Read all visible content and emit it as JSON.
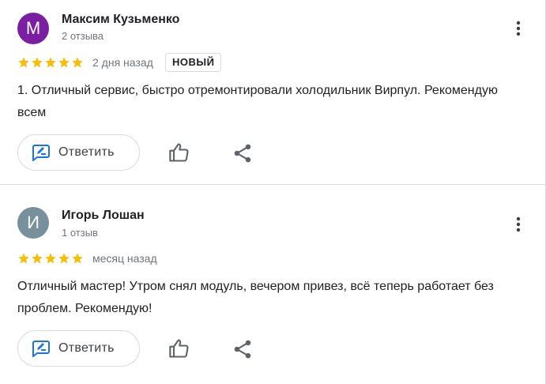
{
  "colors": {
    "avatar_1": "#7b1fa2",
    "avatar_2": "#78909c",
    "star": "#fbbc04",
    "accent": "#1a73e8",
    "text_secondary": "#70757a",
    "divider": "#dadce0"
  },
  "reviews": [
    {
      "avatar_letter": "М",
      "author": "Максим Кузьменко",
      "review_count": "2 отзыва",
      "rating": 5,
      "date": "2 дня назад",
      "badge": "НОВЫЙ",
      "text": "1. Отличный сервис, быстро отремонтировали холодильник Вирпул. Рекомендую всем",
      "reply_label": "Ответить",
      "icons": [
        "more-vert-icon",
        "star-icon",
        "reply-edit-icon",
        "thumb-up-icon",
        "share-icon"
      ]
    },
    {
      "avatar_letter": "И",
      "author": "Игорь Лошан",
      "review_count": "1 отзыв",
      "rating": 5,
      "date": "месяц назад",
      "text": "Отличный мастер! Утром снял модуль, вечером привез, всё теперь работает без проблем. Рекомендую!",
      "reply_label": "Ответить",
      "icons": [
        "more-vert-icon",
        "star-icon",
        "reply-edit-icon",
        "thumb-up-icon",
        "share-icon"
      ]
    }
  ]
}
